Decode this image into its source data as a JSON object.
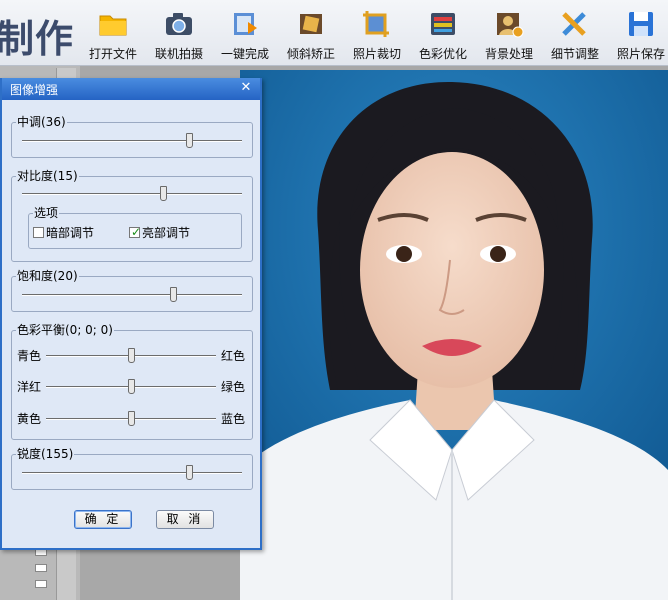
{
  "app": {
    "title": "制作"
  },
  "toolbar": {
    "items": [
      {
        "label": "打开文件",
        "icon": "folder-icon"
      },
      {
        "label": "联机拍摄",
        "icon": "camera-icon"
      },
      {
        "label": "一键完成",
        "icon": "auto-complete-icon"
      },
      {
        "label": "倾斜矫正",
        "icon": "tilt-correct-icon"
      },
      {
        "label": "照片裁切",
        "icon": "crop-icon"
      },
      {
        "label": "色彩优化",
        "icon": "color-optimize-icon"
      },
      {
        "label": "背景处理",
        "icon": "background-icon"
      },
      {
        "label": "细节调整",
        "icon": "detail-adjust-icon"
      },
      {
        "label": "照片保存",
        "icon": "save-icon"
      }
    ]
  },
  "dialog": {
    "title": "图像增强",
    "midtone": {
      "label": "中调(36)",
      "value": 36
    },
    "contrast": {
      "label": "对比度(15)",
      "value": 15
    },
    "options": {
      "label": "选项",
      "dark_adjust": {
        "label": "暗部调节",
        "checked": false
      },
      "bright_adjust": {
        "label": "亮部调节",
        "checked": true
      }
    },
    "saturation": {
      "label": "饱和度(20)",
      "value": 20
    },
    "color_balance": {
      "label": "色彩平衡(0; 0; 0)",
      "rows": [
        {
          "left": "青色",
          "right": "红色",
          "value": 0
        },
        {
          "left": "洋红",
          "right": "绿色",
          "value": 0
        },
        {
          "left": "黄色",
          "right": "蓝色",
          "value": 0
        }
      ]
    },
    "sharpness": {
      "label": "锐度(155)",
      "value": 155
    },
    "ok_label": "确 定",
    "cancel_label": "取 消"
  },
  "colors": {
    "accent": "#2563c4",
    "photo_background": "#1c6ea8",
    "dialog_bg": "#dfe8f6"
  }
}
